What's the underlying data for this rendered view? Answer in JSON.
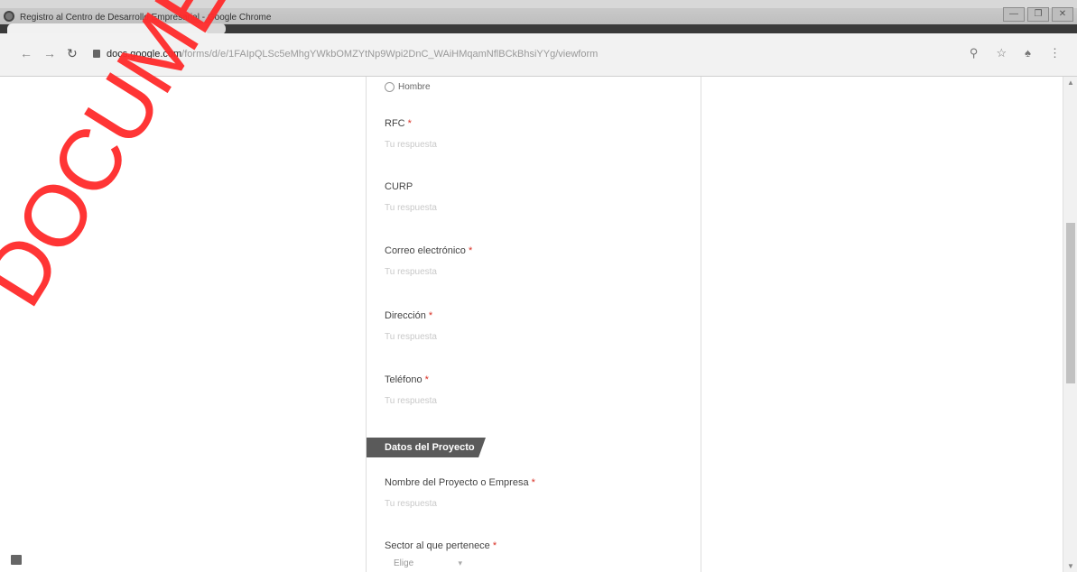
{
  "window": {
    "title": "Registro al Centro de Desarrollo Empresarial - Google Chrome",
    "controls": {
      "minimize": "—",
      "maximize": "❐",
      "close": "✕"
    }
  },
  "addressbar": {
    "url_host": "docs.google.com",
    "url_path": "/forms/d/e/1FAIpQLSc5eMhgYWkbOMZYtNp9Wpi2DnC_WAiHMqamNflBCkBhsiYYg/viewform"
  },
  "form": {
    "radio_option": "Hombre",
    "fields": [
      {
        "label": "RFC",
        "required": "*",
        "placeholder": "Tu respuesta"
      },
      {
        "label": "CURP",
        "required": "",
        "placeholder": "Tu respuesta"
      },
      {
        "label": "Correo electrónico",
        "required": "*",
        "placeholder": "Tu respuesta"
      },
      {
        "label": "Dirección",
        "required": "*",
        "placeholder": "Tu respuesta"
      },
      {
        "label": "Teléfono",
        "required": "*",
        "placeholder": "Tu respuesta"
      }
    ],
    "section_title": "Datos del Proyecto",
    "project_field": {
      "label": "Nombre del Proyecto o Empresa",
      "required": "*",
      "placeholder": "Tu respuesta"
    },
    "sector_field": {
      "label": "Sector al que pertenece",
      "required": "*",
      "select_value": "Elige"
    }
  },
  "watermark": "DOCUMENTO NO",
  "icons": {
    "back": "back-arrow-icon",
    "forward": "forward-arrow-icon",
    "reload": "reload-icon",
    "zoom": "search-icon",
    "bookmark": "star-icon",
    "extension": "extension-icon",
    "menu": "kebab-menu-icon"
  },
  "colors": {
    "accent": "#d93025",
    "watermark": "#ff2b2b",
    "banner": "#5a5a5a"
  }
}
